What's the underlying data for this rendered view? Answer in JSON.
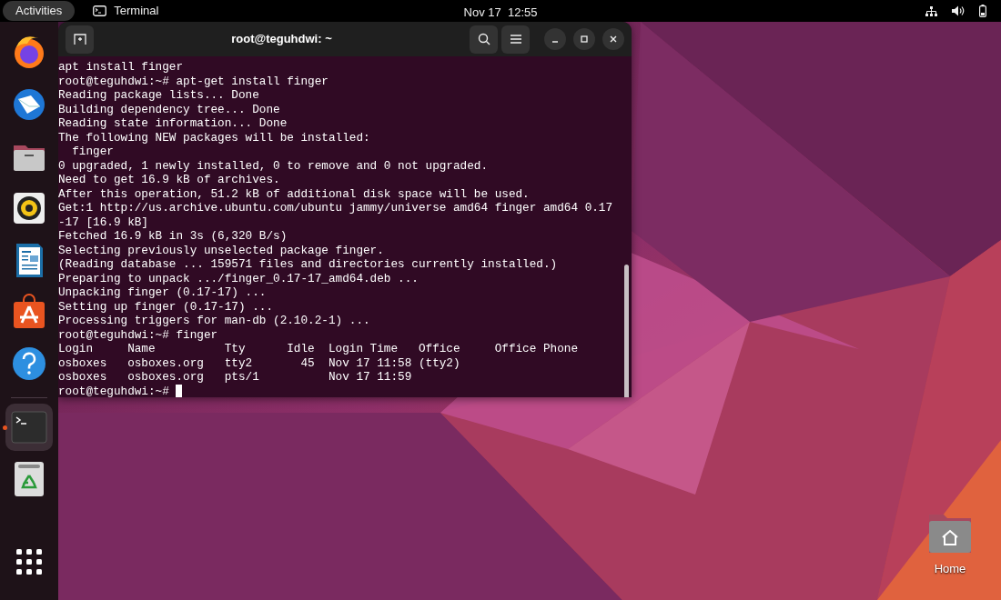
{
  "top_bar": {
    "activities": "Activities",
    "app_menu": "Terminal",
    "clock": "Nov 17  12:55"
  },
  "dock": {
    "items": [
      {
        "kind": "browser",
        "running": false
      },
      {
        "kind": "mail",
        "running": false
      },
      {
        "kind": "folder",
        "running": false
      },
      {
        "kind": "speaker",
        "running": false
      },
      {
        "kind": "document",
        "running": false
      },
      {
        "kind": "store",
        "running": false
      },
      {
        "kind": "help",
        "running": false
      },
      {
        "kind": "terminal",
        "running": true
      },
      {
        "kind": "trash",
        "running": false
      }
    ]
  },
  "terminal": {
    "title": "root@teguhdwi: ~",
    "lines": [
      "apt install finger",
      "root@teguhdwi:~# apt-get install finger",
      "Reading package lists... Done",
      "Building dependency tree... Done",
      "Reading state information... Done",
      "The following NEW packages will be installed:",
      "  finger",
      "0 upgraded, 1 newly installed, 0 to remove and 0 not upgraded.",
      "Need to get 16.9 kB of archives.",
      "After this operation, 51.2 kB of additional disk space will be used.",
      "Get:1 http://us.archive.ubuntu.com/ubuntu jammy/universe amd64 finger amd64 0.17",
      "-17 [16.9 kB]",
      "Fetched 16.9 kB in 3s (6,320 B/s)",
      "Selecting previously unselected package finger.",
      "(Reading database ... 159571 files and directories currently installed.)",
      "Preparing to unpack .../finger_0.17-17_amd64.deb ...",
      "Unpacking finger (0.17-17) ...",
      "Setting up finger (0.17-17) ...",
      "Processing triggers for man-db (2.10.2-1) ...",
      "root@teguhdwi:~# finger",
      "Login     Name          Tty      Idle  Login Time   Office     Office Phone",
      "osboxes   osboxes.org   tty2       45  Nov 17 11:58 (tty2)",
      "osboxes   osboxes.org   pts/1          Nov 17 11:59"
    ],
    "input_line": {
      "prompt": "root@teguhdwi:~# ",
      "cursor": true
    }
  },
  "desktop_icons": [
    {
      "label": "Home"
    }
  ]
}
